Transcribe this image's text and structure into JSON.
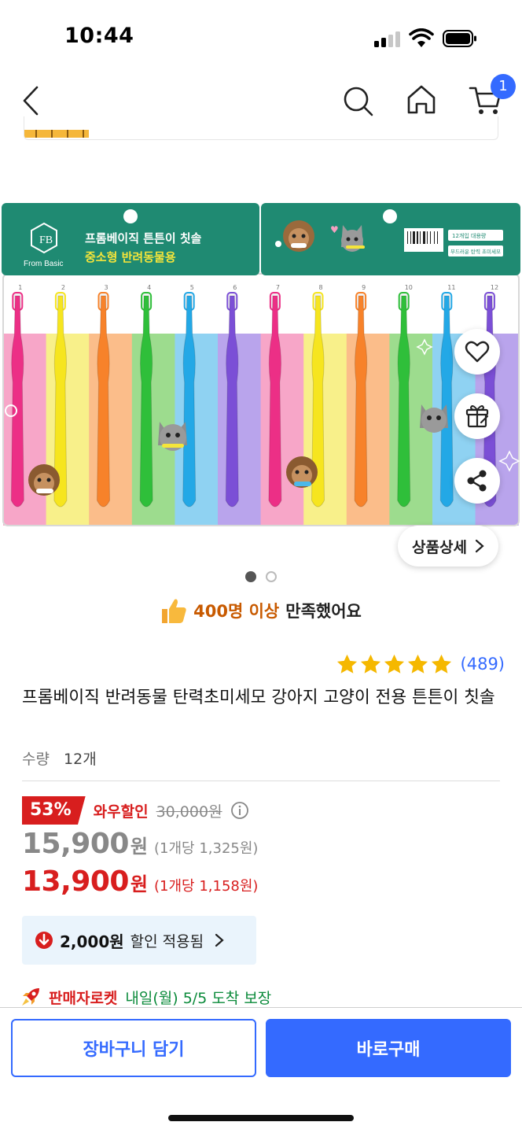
{
  "status_bar": {
    "time": "10:44"
  },
  "nav": {
    "cart_badge": "1"
  },
  "icons": {
    "back": "chevron-left-icon",
    "search": "search-icon",
    "home": "home-icon",
    "cart": "cart-icon",
    "wishlist": "heart-icon",
    "gift": "gift-icon",
    "share": "share-icon",
    "thumb": "thumbs-up-icon",
    "rocket": "rocket-icon",
    "coupon": "arrow-down-circle-icon",
    "info": "info-icon"
  },
  "image": {
    "brand": "From Basic",
    "package_title_line1": "프롬베이직 튼튼이 칫솔",
    "package_title_line2": "중소형 반려동물용",
    "pack_label_top": "12개입 대용량",
    "pack_label_bottom": "부드러운 탄력 초미세모",
    "slot_numbers": [
      "1",
      "2",
      "3",
      "4",
      "5",
      "6",
      "7",
      "8",
      "9",
      "10",
      "11",
      "12"
    ],
    "brush_colors": [
      "#ec2f86",
      "#f6e51f",
      "#f7822a",
      "#2fbf3a",
      "#23a8e6",
      "#7b4fd6",
      "#ec2f86",
      "#f6e51f",
      "#f7822a",
      "#2fbf3a",
      "#23a8e6",
      "#7b4fd6"
    ],
    "package_green": "#1f8a72"
  },
  "gallery": {
    "detail_button": "상품상세",
    "page_count": 2,
    "active_page": 1
  },
  "satisfaction": {
    "highlight": "400명 이상",
    "rest": "만족했어요"
  },
  "rating": {
    "stars": 5,
    "review_count": "(489)"
  },
  "product": {
    "title": "프롬베이직 반려동물 탄력초미세모 강아지 고양이 전용 튼튼이 칫솔",
    "quantity_label": "수량",
    "quantity_value": "12개"
  },
  "pricing": {
    "discount_rate": "53%",
    "wow_label": "와우할인",
    "original_price": "30,000원",
    "regular_price": "15,900",
    "regular_won": "원",
    "regular_unit": "(1개당 1,325원)",
    "wow_price": "13,900",
    "wow_won": "원",
    "wow_unit": "(1개당 1,158원)"
  },
  "coupon": {
    "amount": "2,000원",
    "text": "할인 적용됨"
  },
  "delivery": {
    "rocket_label": "판매자로켓",
    "text": "내일(월) 5/5 도착 보장"
  },
  "actions": {
    "add_to_cart": "장바구니 담기",
    "buy_now": "바로구매"
  },
  "colors": {
    "accent_blue": "#346aff",
    "sale_red": "#d81e1e",
    "star_yellow": "#f5b800",
    "delivery_green": "#0a8a3a",
    "satisfaction_orange": "#c85a00"
  }
}
